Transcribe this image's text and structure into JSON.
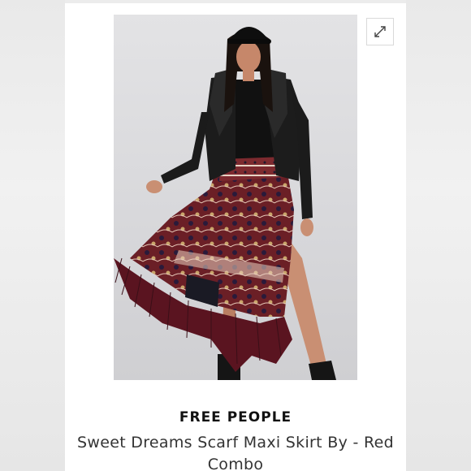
{
  "listing": {
    "brand": "FREE PEOPLE",
    "title": "Sweet Dreams Scarf Maxi Skirt By - Red Combo"
  },
  "icons": {
    "expand": "expand-arrows-icon"
  },
  "colors": {
    "background": "#ececec",
    "card": "#ffffff",
    "brand_text": "#111111",
    "title_text": "#333333"
  }
}
